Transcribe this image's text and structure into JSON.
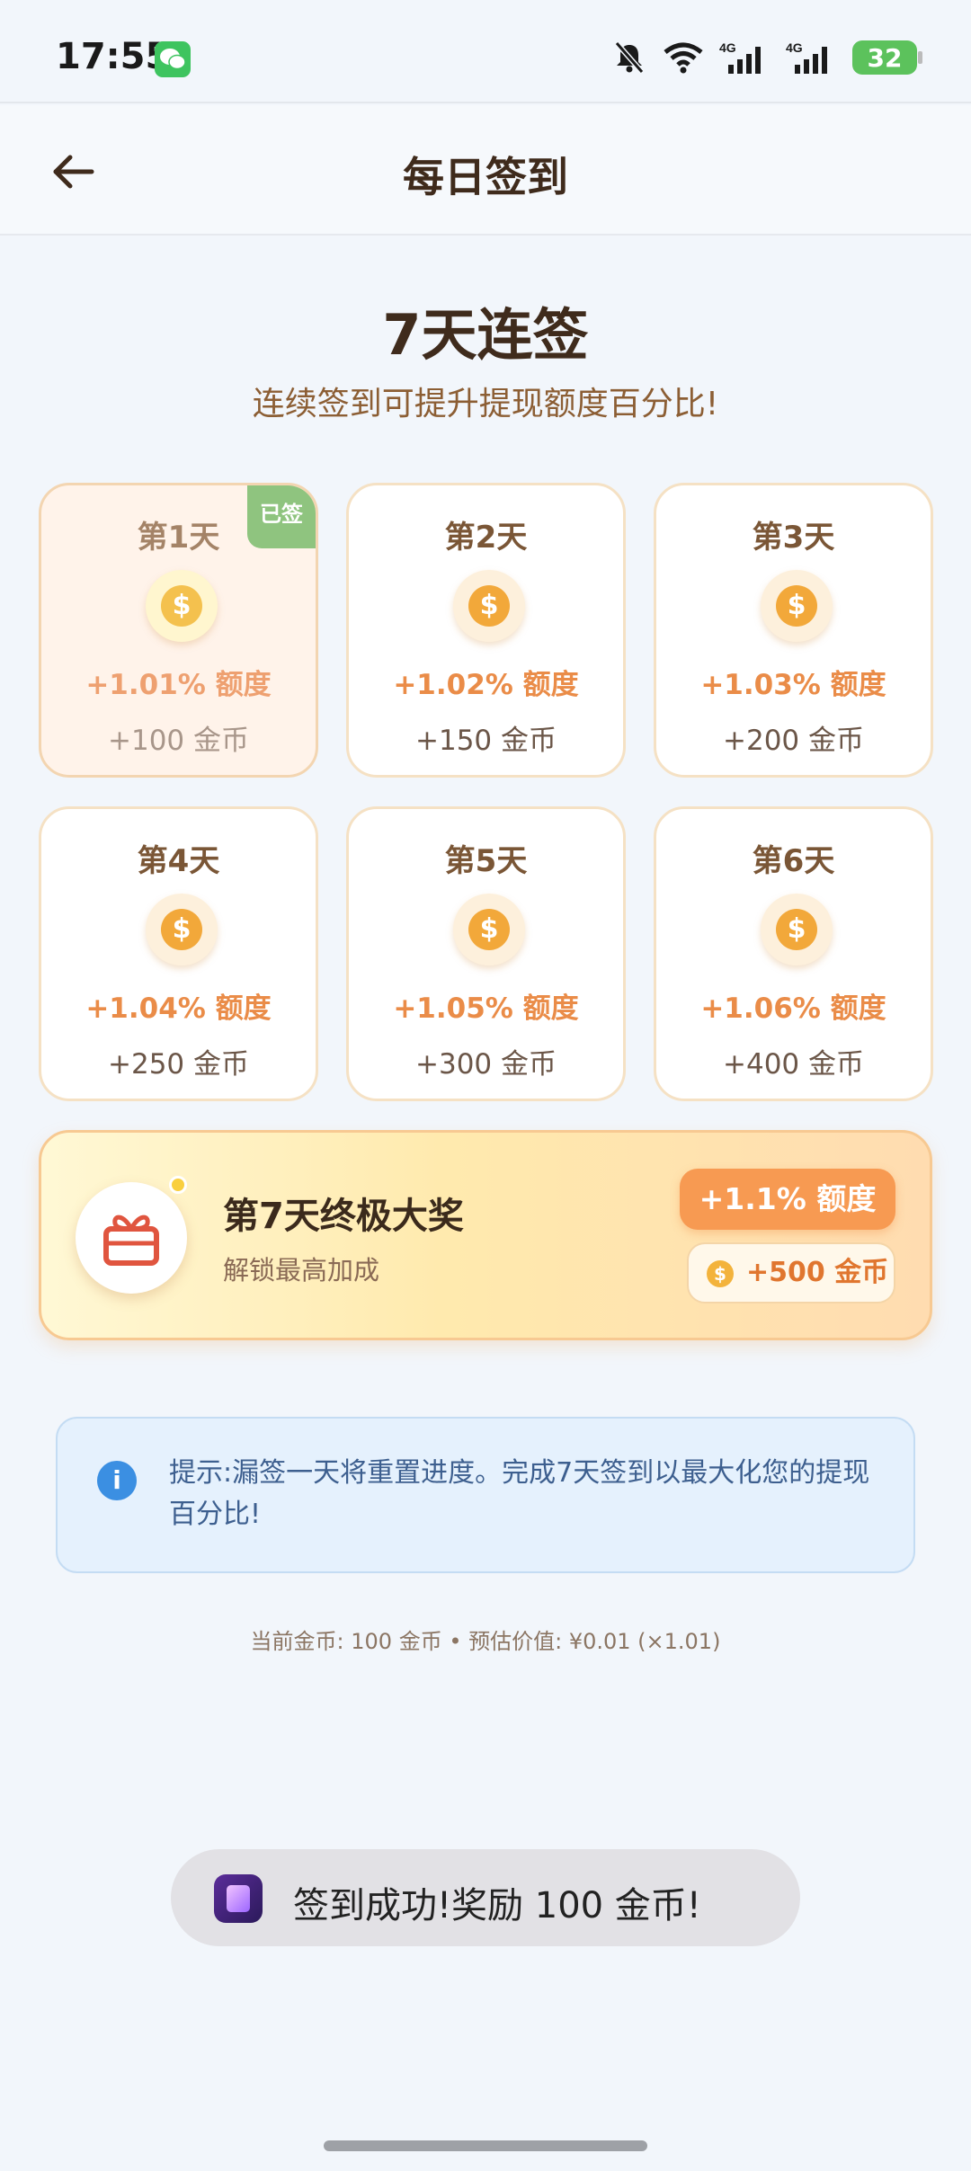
{
  "status_bar": {
    "time": "17:55",
    "battery": "32",
    "network_1": "4G",
    "network_2": "4G"
  },
  "header": {
    "title": "每日签到"
  },
  "hero": {
    "title": "7天连签",
    "subtitle": "连续签到可提升提现额度百分比!"
  },
  "days": [
    {
      "label": "第1天",
      "rate": "+1.01% 额度",
      "coins": "+100 金币",
      "signed": true,
      "badge": "已签"
    },
    {
      "label": "第2天",
      "rate": "+1.02% 额度",
      "coins": "+150 金币",
      "signed": false
    },
    {
      "label": "第3天",
      "rate": "+1.03% 额度",
      "coins": "+200 金币",
      "signed": false
    },
    {
      "label": "第4天",
      "rate": "+1.04% 额度",
      "coins": "+250 金币",
      "signed": false
    },
    {
      "label": "第5天",
      "rate": "+1.05% 额度",
      "coins": "+300 金币",
      "signed": false
    },
    {
      "label": "第6天",
      "rate": "+1.06% 额度",
      "coins": "+400 金币",
      "signed": false
    }
  ],
  "grand_prize": {
    "title": "第7天终极大奖",
    "subtitle": "解锁最高加成",
    "rate": "+1.1% 额度",
    "coins": "+500 金币"
  },
  "tip": {
    "text": "提示:漏签一天将重置进度。完成7天签到以最大化您的提现百分比!"
  },
  "current_info": "当前金币: 100 金币 • 预估价值: ¥0.01 (×1.01)",
  "toast": {
    "text": "签到成功!奖励 100 金币!"
  },
  "icons": {
    "coin_symbol": "$",
    "info_symbol": "i"
  },
  "colors": {
    "accent_orange": "#f79a52",
    "signed_green": "#8fc47f",
    "tip_blue": "#3b8fe2"
  }
}
